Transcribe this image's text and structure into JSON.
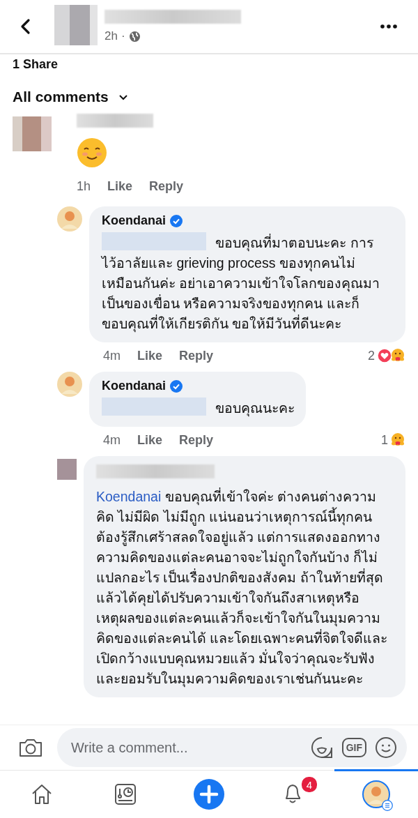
{
  "header": {
    "time": "2h",
    "separator": "·"
  },
  "shares": "1 Share",
  "filter": {
    "label": "All comments"
  },
  "comments": [
    {
      "kind": "top",
      "author": {
        "kind": "redacted"
      },
      "body": {
        "kind": "emoji"
      },
      "time": "1h",
      "actions": [
        "Like",
        "Reply"
      ]
    },
    {
      "kind": "reply",
      "author": {
        "kind": "name",
        "text": "Koendanai",
        "verified": true
      },
      "body": {
        "kind": "text",
        "redacted_mention": true,
        "text": "ขอบคุณที่มาตอบนะคะ การไว้อาลัยและ grieving process ของทุกคนไม่เหมือนกันค่ะ อย่าเอาความเข้าใจโลกของคุณมาเป็นของเขื่อน หรือความจริงของทุกคน และก็ขอบคุณที่ให้เกียรติกัน ขอให้มีวันที่ดีนะคะ"
      },
      "time": "4m",
      "actions": [
        "Like",
        "Reply"
      ],
      "reactions": {
        "count": "2",
        "icons": [
          {
            "kind": "love"
          },
          {
            "kind": "care"
          }
        ]
      }
    },
    {
      "kind": "reply",
      "author": {
        "kind": "name",
        "text": "Koendanai",
        "verified": true
      },
      "body": {
        "kind": "text",
        "redacted_mention": true,
        "text": "ขอบคุณนะคะ"
      },
      "time": "4m",
      "actions": [
        "Like",
        "Reply"
      ],
      "reactions": {
        "count": "1",
        "icons": [
          {
            "kind": "care"
          }
        ]
      }
    },
    {
      "kind": "reply",
      "author": {
        "kind": "redacted"
      },
      "body": {
        "kind": "text",
        "mention": "Koendanai",
        "text": "ขอบคุณที่เข้าใจค่ะ ต่างคนต่างความคิด ไม่มีผิด ไม่มีถูก แน่นอนว่าเหตุการณ์นี้ทุกคนต้องรู้สึกเศร้าสลดใจอยู่แล้ว แต่การแสดงออกทางความคิดของแต่ละคนอาจจะไม่ถูกใจกันบ้าง ก็ไม่แปลกอะไร เป็นเรื่องปกติของสังคม ถ้าในท้ายที่สุดแล้วได้คุยได้ปรับความเข้าใจกันถึงสาเหตุหรือเหตุผลของแต่ละคนแล้วก็จะเข้าใจกันในมุมความคิดของแต่ละคนได้ และโดยเฉพาะคนที่จิตใจดีและเปิดกว้างแบบคุณหมวยแล้ว มั่นใจว่าคุณจะรับฟังและยอมรับในมุมความคิดของเราเช่นกันนะคะ"
      }
    }
  ],
  "composer": {
    "placeholder": "Write a comment...",
    "gif_label": "GIF"
  },
  "nav": [
    {
      "kind": "home",
      "selected": false
    },
    {
      "kind": "feeds",
      "selected": false
    },
    {
      "kind": "create",
      "selected": false
    },
    {
      "kind": "notifications",
      "selected": false,
      "badge": "4"
    },
    {
      "kind": "profile",
      "selected": true
    }
  ]
}
